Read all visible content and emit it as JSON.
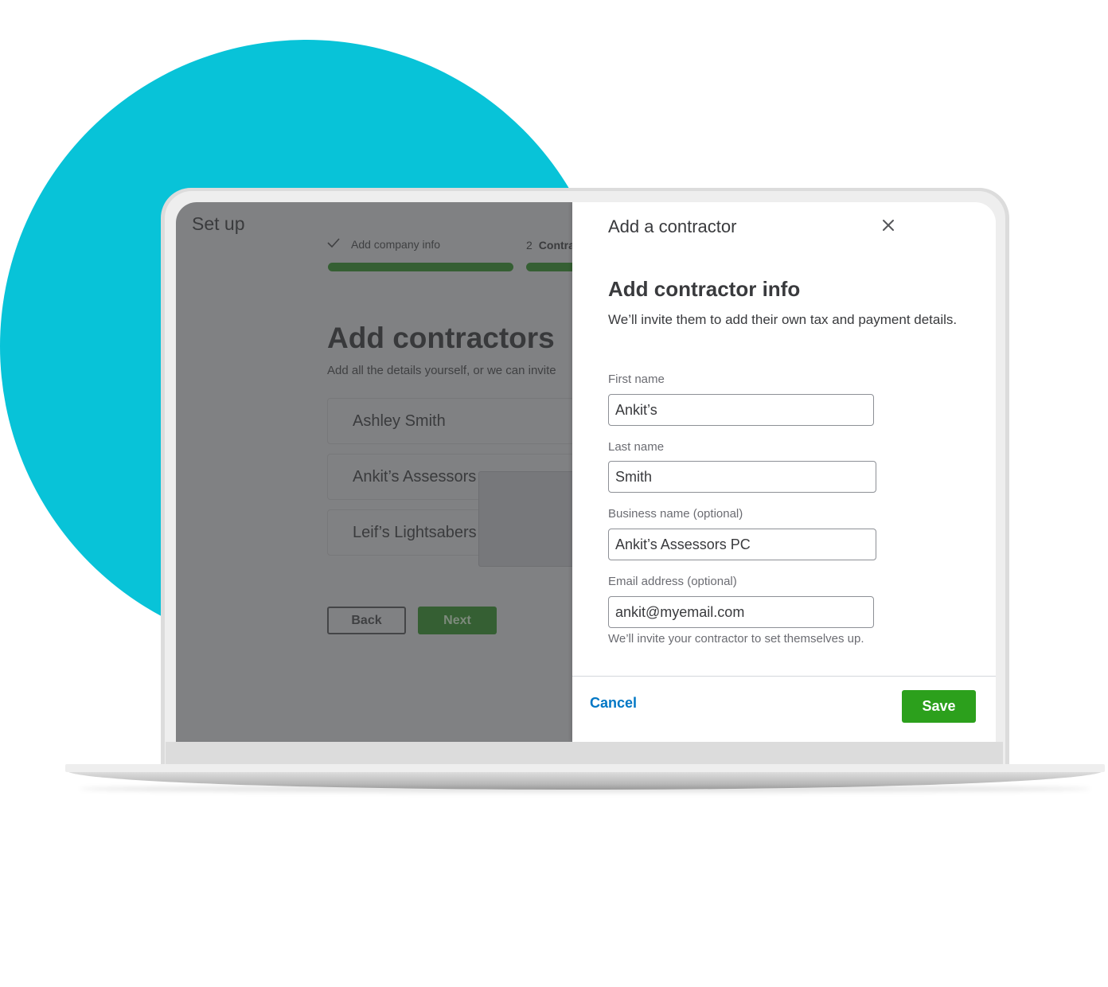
{
  "colors": {
    "accent_teal": "#08c3d8",
    "primary_green": "#2ca01c",
    "link_blue": "#0077c5",
    "text_dark": "#393a3d",
    "overlay_gray": "#808183"
  },
  "background_app": {
    "title": "Set up",
    "steps": [
      {
        "status": "complete",
        "icon": "check-icon",
        "label": "Add company info"
      },
      {
        "status": "current",
        "number": "2",
        "label": "Contra"
      }
    ],
    "heading": "Add contractors",
    "subtitle": "Add all the details yourself, or we can invite",
    "contractors": [
      {
        "name": "Ashley Smith"
      },
      {
        "name": "Ankit’s Assessors"
      },
      {
        "name": "Leif’s Lightsabers"
      }
    ],
    "back_label": "Back",
    "next_label": "Next"
  },
  "drawer": {
    "title": "Add a contractor",
    "close_icon": "close-icon",
    "heading": "Add contractor info",
    "subtitle": "We’ll invite them to add their own tax and payment details.",
    "fields": {
      "first_name": {
        "label": "First name",
        "value": "Ankit’s"
      },
      "last_name": {
        "label": "Last name",
        "value": "Smith"
      },
      "business_name": {
        "label": "Business name (optional)",
        "value": "Ankit’s Assessors PC"
      },
      "email": {
        "label": "Email address (optional)",
        "value": "ankit@myemail.com",
        "help": "We’ll invite your contractor to set themselves up."
      }
    },
    "cancel_label": "Cancel",
    "save_label": "Save"
  }
}
